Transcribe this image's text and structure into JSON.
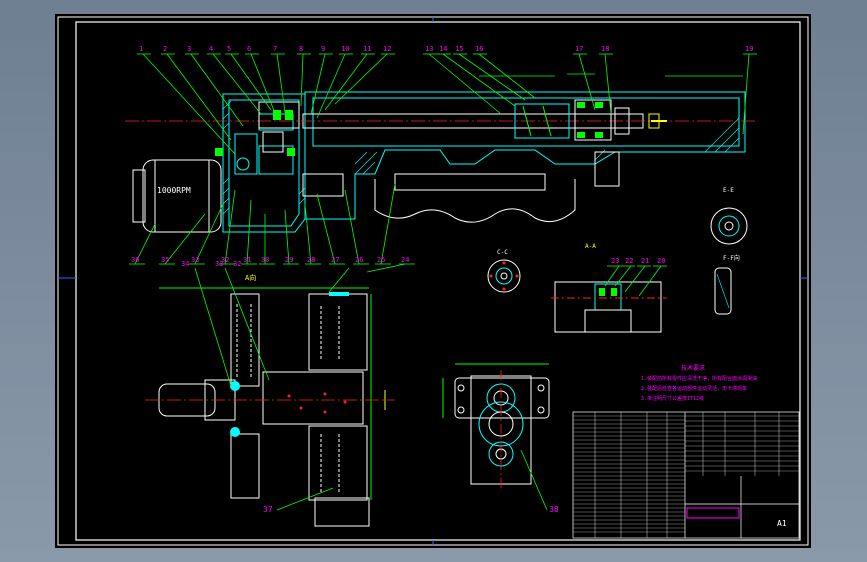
{
  "drawing": {
    "leaders_top": [
      "1",
      "2",
      "3",
      "4",
      "5",
      "6",
      "7",
      "8",
      "9",
      "10",
      "11",
      "12",
      "13",
      "14",
      "15",
      "16",
      "17",
      "18",
      "19"
    ],
    "leaders_bottom": [
      "36",
      "35",
      "33",
      "32",
      "31",
      "30",
      "29",
      "28",
      "27",
      "26",
      "25",
      "24"
    ],
    "leaders_plan": [
      "34",
      "33",
      "32",
      "A向"
    ],
    "plan_bottom_label": "37",
    "front_view_label": "38",
    "motor_label": "1000RPM",
    "section_cc_label": "C-C",
    "section_aa_label": "A-A",
    "section_ee_label": "E-E",
    "section_ff_label": "F-F向",
    "detail_labels": [
      "23",
      "22",
      "21",
      "20"
    ],
    "notes_title": "技术要求",
    "notes": [
      "1.装配前所有零件应清洗干净，所有配合面涂润滑油",
      "2.装配后检查各运动部件运动灵活，无卡滞现象",
      "3.未注明尺寸公差按IT12级"
    ],
    "title_block_name": "A1"
  },
  "colors": {
    "frame": "#ffffff",
    "outline": "#ffffff",
    "leader": "#00ff00",
    "number": "#ff00ff",
    "section": "#00ffff",
    "center": "#ff2020",
    "note": "#ff00ff",
    "dimension": "#ffff00"
  }
}
